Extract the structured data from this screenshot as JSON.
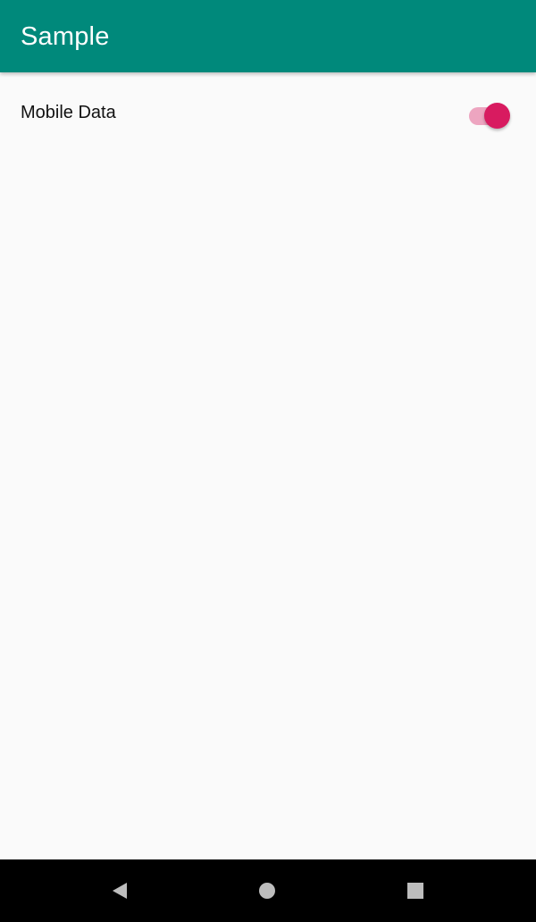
{
  "app_bar": {
    "title": "Sample"
  },
  "settings": {
    "mobile_data": {
      "label": "Mobile Data",
      "checked": true
    }
  },
  "navigation": {
    "back_icon": "back-icon",
    "home_icon": "home-icon",
    "recents_icon": "recents-icon"
  },
  "colors": {
    "app_bar": "#00897b",
    "accent": "#d81b60",
    "background": "#fafafa",
    "navigation_bar": "#000000"
  }
}
